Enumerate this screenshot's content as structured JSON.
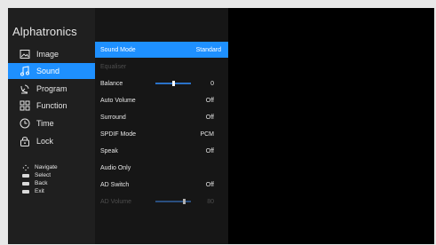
{
  "brand": "Alphatronics",
  "menu": [
    {
      "label": "Image",
      "icon": "image-icon"
    },
    {
      "label": "Sound",
      "icon": "music-note-icon",
      "active": true
    },
    {
      "label": "Program",
      "icon": "satellite-dish-icon"
    },
    {
      "label": "Function",
      "icon": "grid-icon"
    },
    {
      "label": "Time",
      "icon": "clock-icon"
    },
    {
      "label": "Lock",
      "icon": "lock-icon"
    }
  ],
  "hints": [
    {
      "label": "Navigate",
      "icon": "navigate-icon"
    },
    {
      "label": "Select",
      "icon": "select-key-icon"
    },
    {
      "label": "Back",
      "icon": "back-key-icon"
    },
    {
      "label": "Exit",
      "icon": "exit-key-icon"
    }
  ],
  "settings": [
    {
      "label": "Sound Mode",
      "value": "Standard",
      "active": true
    },
    {
      "label": "Equaliser",
      "value": "",
      "disabled": true
    },
    {
      "label": "Balance",
      "value": "0",
      "slider_level": 0.5
    },
    {
      "label": "Auto Volume",
      "value": "Off"
    },
    {
      "label": "Surround",
      "value": "Off"
    },
    {
      "label": "SPDIF Mode",
      "value": "PCM"
    },
    {
      "label": "Speak",
      "value": "Off"
    },
    {
      "label": "Audio Only",
      "value": ""
    },
    {
      "label": "AD Switch",
      "value": "Off"
    },
    {
      "label": "AD Volume",
      "value": "80",
      "slider_level": 0.8,
      "disabled": true
    }
  ],
  "colors": {
    "accent": "#1e90ff",
    "panel_left": "#1f1f1f",
    "panel_mid": "#161616"
  }
}
